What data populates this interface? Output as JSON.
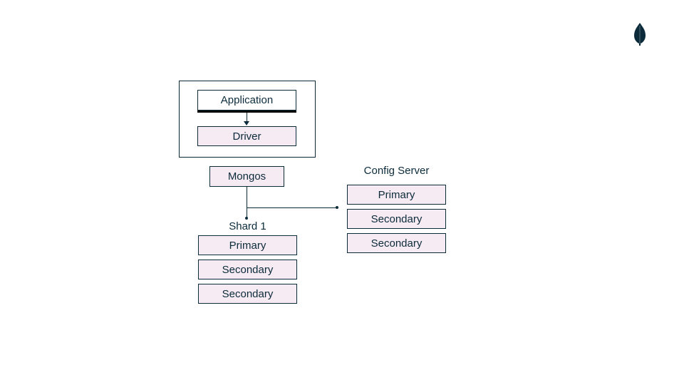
{
  "logo": {
    "name": "mongodb-leaf-icon",
    "fill": "#0b2b3a"
  },
  "app_container": {
    "application_label": "Application",
    "driver_label": "Driver"
  },
  "mongos_label": "Mongos",
  "shard1": {
    "title": "Shard 1",
    "primary": "Primary",
    "secondary1": "Secondary",
    "secondary2": "Secondary"
  },
  "config_server": {
    "title": "Config Server",
    "primary": "Primary",
    "secondary1": "Secondary",
    "secondary2": "Secondary"
  }
}
